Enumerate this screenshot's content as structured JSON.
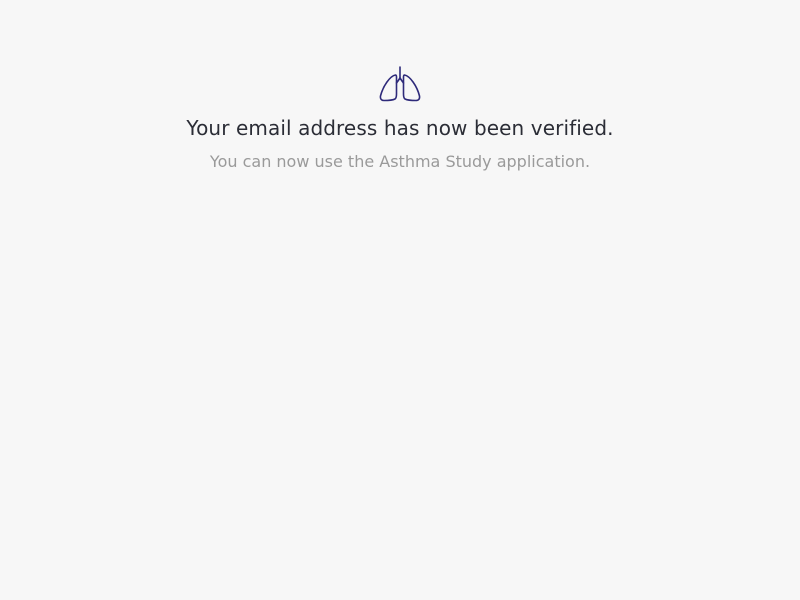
{
  "icon": {
    "name": "lungs-icon",
    "color": "#2e2a7a"
  },
  "verification": {
    "title": "Your email address has now been verified.",
    "subtitle": "You can now use the Asthma Study application."
  },
  "colors": {
    "background": "#f7f7f7",
    "title_text": "#2b2d36",
    "subtitle_text": "#9a9a9a"
  }
}
